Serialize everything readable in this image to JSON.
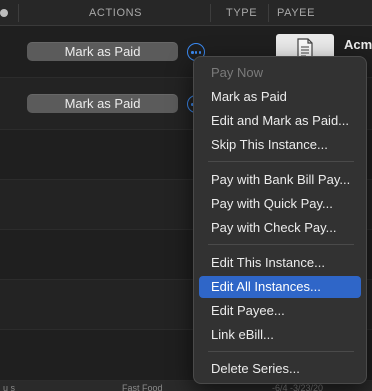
{
  "header": {
    "columns": {
      "actions": "ACTIONS",
      "type": "TYPE",
      "payee": "PAYEE"
    }
  },
  "rows": [
    {
      "action_label": "Mark as Paid",
      "payee": "Acm"
    },
    {
      "action_label": "Mark as Paid"
    }
  ],
  "bottom_strip": {
    "left": "u s",
    "middle": "Fast Food",
    "right": "-6/4   -3/23/20"
  },
  "context_menu": {
    "items": [
      {
        "label": "Pay Now",
        "enabled": false
      },
      {
        "label": "Mark as Paid",
        "enabled": true
      },
      {
        "label": "Edit and Mark as Paid...",
        "enabled": true
      },
      {
        "label": "Skip This Instance...",
        "enabled": true
      },
      {
        "label": "Pay with Bank Bill Pay...",
        "enabled": true
      },
      {
        "label": "Pay with Quick Pay...",
        "enabled": true
      },
      {
        "label": "Pay with Check Pay...",
        "enabled": true
      },
      {
        "label": "Edit This Instance...",
        "enabled": true
      },
      {
        "label": "Edit All Instances...",
        "enabled": true,
        "highlighted": true
      },
      {
        "label": "Edit Payee...",
        "enabled": true
      },
      {
        "label": "Link eBill...",
        "enabled": true
      },
      {
        "label": "Delete Series...",
        "enabled": true
      }
    ]
  },
  "icons": {
    "more_button": "ellipsis-circle-icon",
    "bill": "document-icon",
    "header_indicator": "dot-icon"
  },
  "colors": {
    "accent": "#3b8af2",
    "menu_highlight": "#2f66c8",
    "menu_background": "#323232",
    "action_button": "#5b5b5b"
  }
}
